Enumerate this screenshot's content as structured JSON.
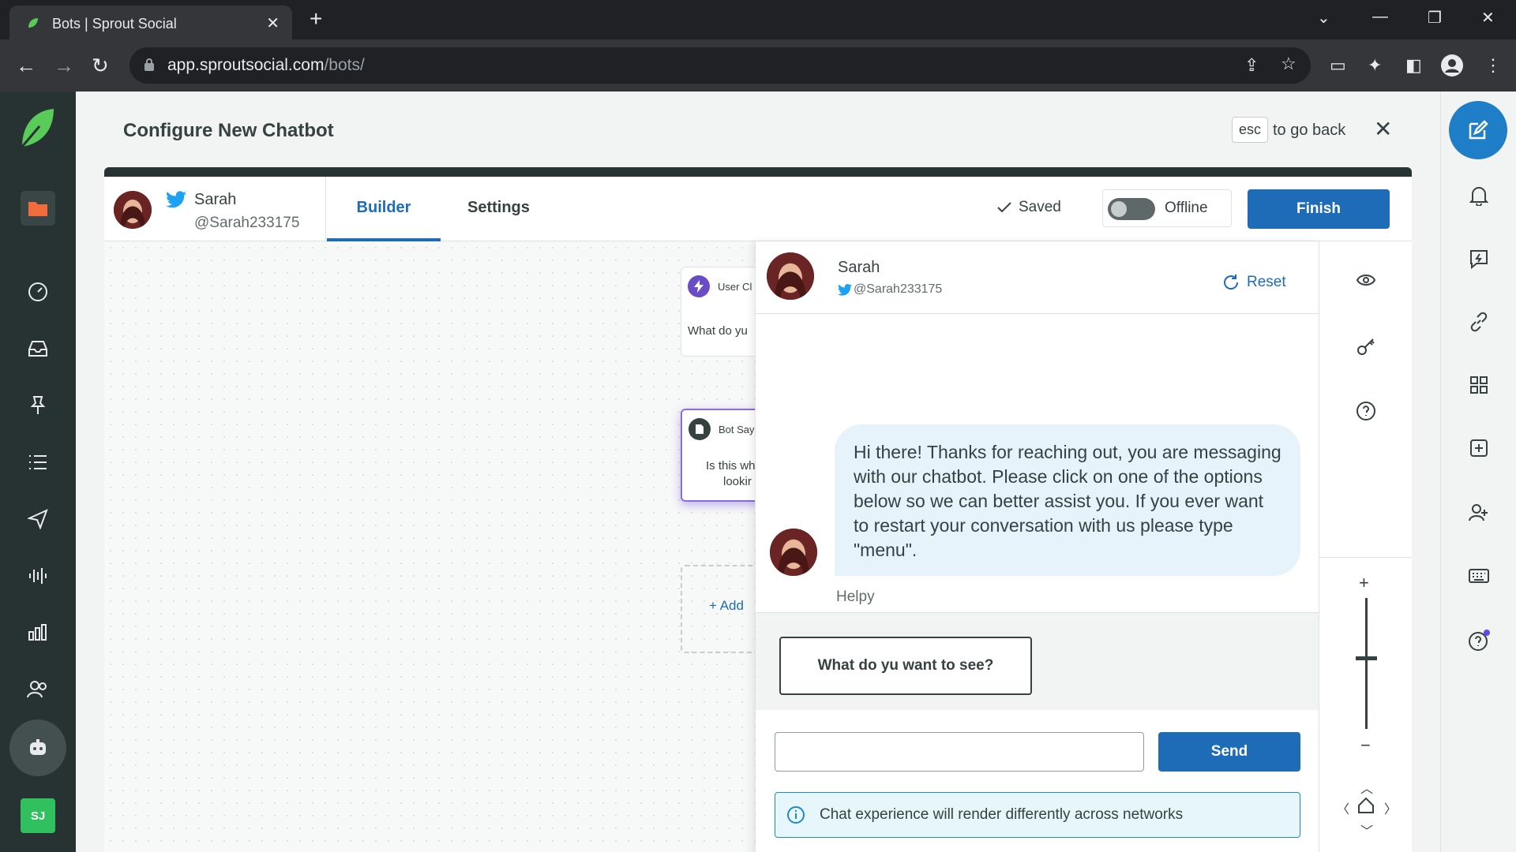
{
  "browser": {
    "tab_title": "Bots | Sprout Social",
    "url_host": "app.sproutsocial.com",
    "url_path": "/bots/"
  },
  "page": {
    "title": "Configure New Chatbot",
    "esc_key": "esc",
    "esc_hint": "to go back"
  },
  "profile": {
    "name": "Sarah",
    "handle": "@Sarah233175"
  },
  "tabs": {
    "builder": "Builder",
    "settings": "Settings"
  },
  "status": {
    "saved": "Saved",
    "online_state": "Offline",
    "finish": "Finish"
  },
  "canvas": {
    "node1_header": "User Cl",
    "node1_body": "What do yu",
    "node2_header": "Bot Say",
    "node2_line1": "Is this wh",
    "node2_line2": "lookir",
    "add_label": "Add"
  },
  "preview": {
    "name": "Sarah",
    "handle": "@Sarah233175",
    "reset": "Reset",
    "message": "Hi there! Thanks for reaching out, you are messaging with our chatbot. Please click on one of the options below so we can better assist you. If you ever want to restart your conversation with us please type \"menu\".",
    "bot_name": "Helpy",
    "quick_reply": "What do yu want to see?",
    "input_value": "",
    "send": "Send",
    "info": "Chat experience will render differently across networks"
  },
  "leftnav": {
    "avatar_initials": "SJ"
  },
  "colors": {
    "brand_blue": "#1e6bb8",
    "sidebar_dark": "#273333",
    "sprout_green": "#30c05d",
    "bubble": "#e6f3fb"
  }
}
